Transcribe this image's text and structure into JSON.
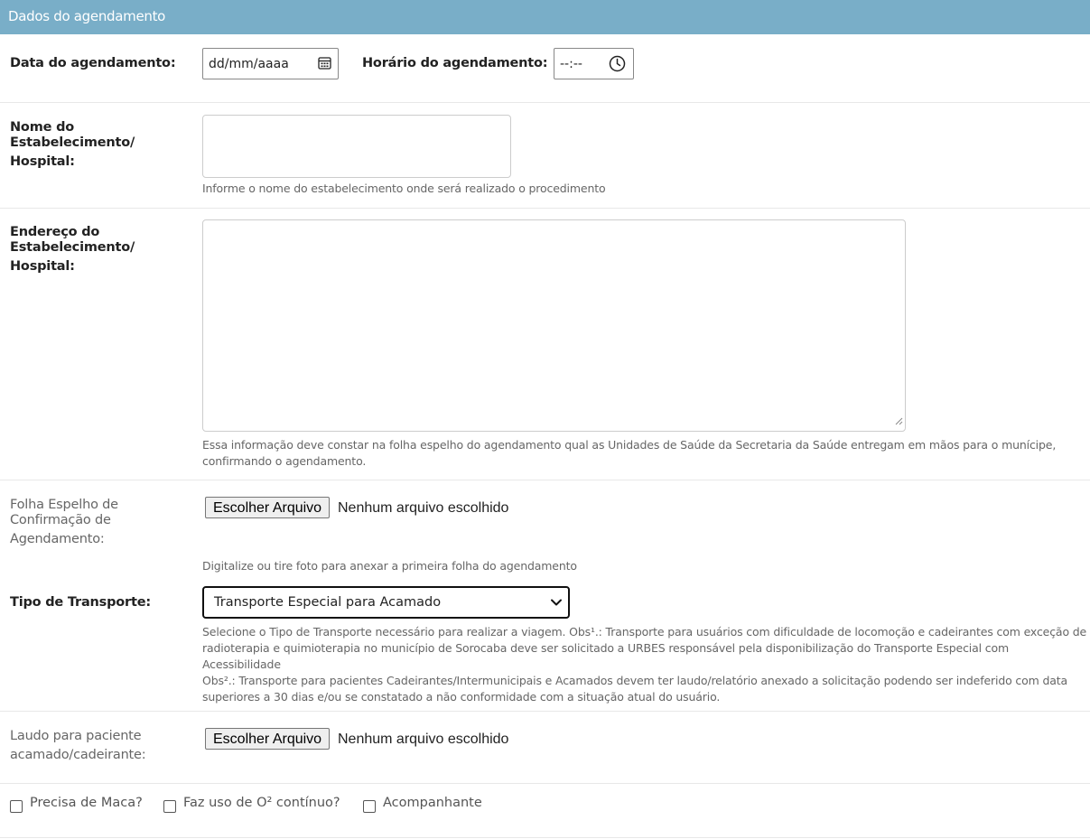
{
  "section": {
    "title": "Dados do agendamento"
  },
  "scheduling": {
    "date_label": "Data do agendamento:",
    "date_placeholder": "dd/mm/aaaa",
    "time_label": "Horário do agendamento:",
    "time_placeholder": "--:--"
  },
  "establishment_name": {
    "label_line1": "Nome do",
    "label_line2": "Estabelecimento/",
    "label_line3": "Hospital:",
    "value": "",
    "help": "Informe o nome do estabelecimento onde será realizado o procedimento"
  },
  "establishment_address": {
    "label_line1": "Endereço do",
    "label_line2": "Estabelecimento/",
    "label_line3": "Hospital:",
    "value": "",
    "help_line1": "Essa informação deve constar na folha espelho do agendamento qual as Unidades de Saúde da Secretaria da Saúde entregam em mãos para o munícipe,",
    "help_line2": "confirmando o agendamento."
  },
  "mirror_sheet": {
    "label_line1": "Folha Espelho de",
    "label_line2": "Confirmação de",
    "label_line3": "Agendamento:",
    "button_label": "Escolher Arquivo",
    "file_status": "Nenhum arquivo escolhido",
    "help": "Digitalize ou tire foto para anexar a primeira folha do agendamento"
  },
  "transport": {
    "label": "Tipo de Transporte:",
    "selected": "Transporte Especial para Acamado",
    "help_line1": "Selecione o Tipo de Transporte necessário para realizar a viagem. Obs¹.: Transporte para usuários com dificuldade de locomoção e cadeirantes com exceção de",
    "help_line2": "radioterapia e quimioterapia no município de Sorocaba deve ser solicitado a URBES responsável pela disponibilização do Transporte Especial com Acessibilidade",
    "help_line3": "Obs².: Transporte para pacientes Cadeirantes/Intermunicipais e Acamados devem ter laudo/relatório anexado a solicitação podendo ser indeferido com data",
    "help_line4": "superiores a 30 dias e/ou se constatado a não conformidade com a situação atual do usuário."
  },
  "report": {
    "label_line1": "Laudo para paciente",
    "label_line2": "acamado/cadeirante:",
    "button_label": "Escolher Arquivo",
    "file_status": "Nenhum arquivo escolhido"
  },
  "options": {
    "stretcher": {
      "label": "Precisa de Maca?",
      "checked": false
    },
    "oxygen": {
      "label": "Faz uso de O² contínuo?",
      "checked": false
    },
    "companion": {
      "label": "Acompanhante",
      "checked": false
    }
  },
  "icons": {
    "date": "calendar-icon",
    "time": "clock-icon",
    "select": "chevron-down-icon"
  },
  "colors": {
    "header_bg": "#79aec8",
    "header_text": "#ffffff",
    "help_text": "#666666"
  }
}
